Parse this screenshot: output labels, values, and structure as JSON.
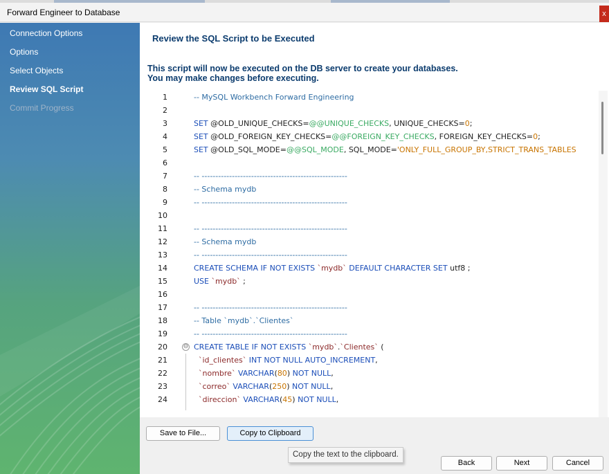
{
  "window": {
    "title": "Forward Engineer to Database",
    "close_label": "x"
  },
  "sidebar": {
    "steps": [
      {
        "label": "Connection Options",
        "state": "done"
      },
      {
        "label": "Options",
        "state": "done"
      },
      {
        "label": "Select Objects",
        "state": "done"
      },
      {
        "label": "Review SQL Script",
        "state": "active"
      },
      {
        "label": "Commit Progress",
        "state": "disabled"
      }
    ]
  },
  "main": {
    "heading": "Review the SQL Script to be Executed",
    "description_line1": "This script will now be executed on the DB server to create your databases.",
    "description_line2": "You may make changes before executing."
  },
  "editor": {
    "lines": [
      {
        "n": "1",
        "tokens": [
          [
            "comment",
            "-- MySQL Workbench Forward Engineering"
          ]
        ]
      },
      {
        "n": "2",
        "tokens": []
      },
      {
        "n": "3",
        "tokens": [
          [
            "kw",
            "SET "
          ],
          [
            "var",
            "@OLD_UNIQUE_CHECKS"
          ],
          [
            "plain",
            "="
          ],
          [
            "fn",
            "@@UNIQUE_CHECKS"
          ],
          [
            "plain",
            ", UNIQUE_CHECKS="
          ],
          [
            "num",
            "0"
          ],
          [
            "plain",
            ";"
          ]
        ]
      },
      {
        "n": "4",
        "tokens": [
          [
            "kw",
            "SET "
          ],
          [
            "var",
            "@OLD_FOREIGN_KEY_CHECKS"
          ],
          [
            "plain",
            "="
          ],
          [
            "fn",
            "@@FOREIGN_KEY_CHECKS"
          ],
          [
            "plain",
            ", FOREIGN_KEY_CHECKS="
          ],
          [
            "num",
            "0"
          ],
          [
            "plain",
            ";"
          ]
        ]
      },
      {
        "n": "5",
        "tokens": [
          [
            "kw",
            "SET "
          ],
          [
            "var",
            "@OLD_SQL_MODE"
          ],
          [
            "plain",
            "="
          ],
          [
            "fn",
            "@@SQL_MODE"
          ],
          [
            "plain",
            ", SQL_MODE="
          ],
          [
            "str",
            "'ONLY_FULL_GROUP_BY,STRICT_TRANS_TABLES"
          ]
        ]
      },
      {
        "n": "6",
        "tokens": []
      },
      {
        "n": "7",
        "tokens": [
          [
            "comment",
            "-- -----------------------------------------------------"
          ]
        ]
      },
      {
        "n": "8",
        "tokens": [
          [
            "comment",
            "-- Schema mydb"
          ]
        ]
      },
      {
        "n": "9",
        "tokens": [
          [
            "comment",
            "-- -----------------------------------------------------"
          ]
        ]
      },
      {
        "n": "10",
        "tokens": []
      },
      {
        "n": "11",
        "tokens": [
          [
            "comment",
            "-- -----------------------------------------------------"
          ]
        ]
      },
      {
        "n": "12",
        "tokens": [
          [
            "comment",
            "-- Schema mydb"
          ]
        ]
      },
      {
        "n": "13",
        "tokens": [
          [
            "comment",
            "-- -----------------------------------------------------"
          ]
        ]
      },
      {
        "n": "14",
        "tokens": [
          [
            "kw",
            "CREATE SCHEMA IF NOT EXISTS "
          ],
          [
            "ident",
            "`mydb`"
          ],
          [
            "kw",
            " DEFAULT CHARACTER SET "
          ],
          [
            "plain",
            "utf8 ;"
          ]
        ]
      },
      {
        "n": "15",
        "tokens": [
          [
            "kw",
            "USE "
          ],
          [
            "ident",
            "`mydb`"
          ],
          [
            "plain",
            " ;"
          ]
        ]
      },
      {
        "n": "16",
        "tokens": []
      },
      {
        "n": "17",
        "tokens": [
          [
            "comment",
            "-- -----------------------------------------------------"
          ]
        ]
      },
      {
        "n": "18",
        "tokens": [
          [
            "comment",
            "-- Table `mydb`.`Clientes`"
          ]
        ]
      },
      {
        "n": "19",
        "tokens": [
          [
            "comment",
            "-- -----------------------------------------------------"
          ]
        ]
      },
      {
        "n": "20",
        "tokens": [
          [
            "kw",
            "CREATE TABLE IF NOT EXISTS "
          ],
          [
            "ident",
            "`mydb`"
          ],
          [
            "plain",
            "."
          ],
          [
            "ident",
            "`Clientes`"
          ],
          [
            "plain",
            " ("
          ]
        ],
        "fold": "⊖"
      },
      {
        "n": "21",
        "tokens": [
          [
            "ident",
            "  `id_clientes`"
          ],
          [
            "kw",
            " INT NOT NULL AUTO_INCREMENT"
          ],
          [
            "plain",
            ","
          ]
        ]
      },
      {
        "n": "22",
        "tokens": [
          [
            "ident",
            "  `nombre`"
          ],
          [
            "kw",
            " VARCHAR"
          ],
          [
            "plain",
            "("
          ],
          [
            "num",
            "80"
          ],
          [
            "plain",
            ") "
          ],
          [
            "kw",
            "NOT NULL"
          ],
          [
            "plain",
            ","
          ]
        ]
      },
      {
        "n": "23",
        "tokens": [
          [
            "ident",
            "  `correo`"
          ],
          [
            "kw",
            " VARCHAR"
          ],
          [
            "plain",
            "("
          ],
          [
            "num",
            "250"
          ],
          [
            "plain",
            ") "
          ],
          [
            "kw",
            "NOT NULL"
          ],
          [
            "plain",
            ","
          ]
        ]
      },
      {
        "n": "24",
        "tokens": [
          [
            "ident",
            "  `direccion`"
          ],
          [
            "kw",
            " VARCHAR"
          ],
          [
            "plain",
            "("
          ],
          [
            "num",
            "45"
          ],
          [
            "plain",
            ") "
          ],
          [
            "kw",
            "NOT NULL"
          ],
          [
            "plain",
            ","
          ]
        ]
      }
    ]
  },
  "buttons": {
    "save": "Save to File...",
    "copy": "Copy to Clipboard",
    "back": "Back",
    "next": "Next",
    "cancel": "Cancel"
  },
  "tooltip": "Copy the text to the clipboard."
}
